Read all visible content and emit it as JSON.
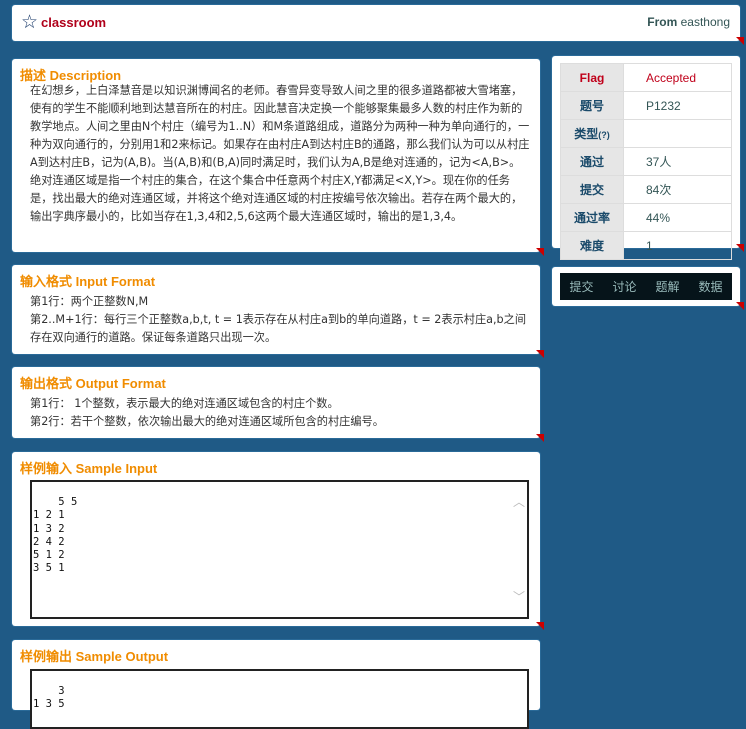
{
  "header": {
    "site_name": "classroom",
    "from_label": "From",
    "author": "easthong"
  },
  "description": {
    "title": "描述 Description",
    "text": "在幻想乡，上白泽慧音是以知识渊博闻名的老师。春雪异变导致人间之里的很多道路都被大雪堵塞，使有的学生不能顺利地到达慧音所在的村庄。因此慧音决定换一个能够聚集最多人数的村庄作为新的教学地点。人间之里由N个村庄（编号为1..N）和M条道路组成，道路分为两种一种为单向通行的，一种为双向通行的，分别用1和2来标记。如果存在由村庄A到达村庄B的通路，那么我们认为可以从村庄A到达村庄B，记为(A,B)。当(A,B)和(B,A)同时满足时，我们认为A,B是绝对连通的，记为<A,B>。绝对连通区域是指一个村庄的集合，在这个集合中任意两个村庄X,Y都满足<X,Y>。现在你的任务是，找出最大的绝对连通区域，并将这个绝对连通区域的村庄按编号依次输出。若存在两个最大的，输出字典序最小的，比如当存在1,3,4和2,5,6这两个最大连通区域时，输出的是1,3,4。"
  },
  "input_format": {
    "title": "输入格式 Input Format",
    "line1": "第1行：两个正整数N,M",
    "line2": "第2..M+1行：每行三个正整数a,b,t, t = 1表示存在从村庄a到b的单向道路，t = 2表示村庄a,b之间存在双向通行的道路。保证每条道路只出现一次。"
  },
  "output_format": {
    "title": "输出格式 Output Format",
    "line1": "第1行： 1个整数，表示最大的绝对连通区域包含的村庄个数。",
    "line2": "第2行：若干个整数，依次输出最大的绝对连通区域所包含的村庄编号。"
  },
  "sample_input": {
    "title": "样例输入 Sample Input",
    "content": "5 5\n1 2 1\n1 3 2\n2 4 2\n5 1 2\n3 5 1"
  },
  "sample_output": {
    "title": "样例输出 Sample Output",
    "content": "3\n1 3 5"
  },
  "stats": [
    {
      "key": "Flag",
      "value": "Accepted"
    },
    {
      "key": "题号",
      "value": "P1232"
    },
    {
      "key": "类型",
      "key_suffix": "(?)",
      "value": ""
    },
    {
      "key": "通过",
      "value": "37人"
    },
    {
      "key": "提交",
      "value": "84次"
    },
    {
      "key": "通过率",
      "value": "44%"
    },
    {
      "key": "难度",
      "value": "1"
    }
  ],
  "actions": [
    "提交",
    "讨论",
    "题解",
    "数据"
  ],
  "colors": {
    "background": "#1f5a86",
    "section_title": "#f08c00",
    "accepted": "#c0001a"
  }
}
